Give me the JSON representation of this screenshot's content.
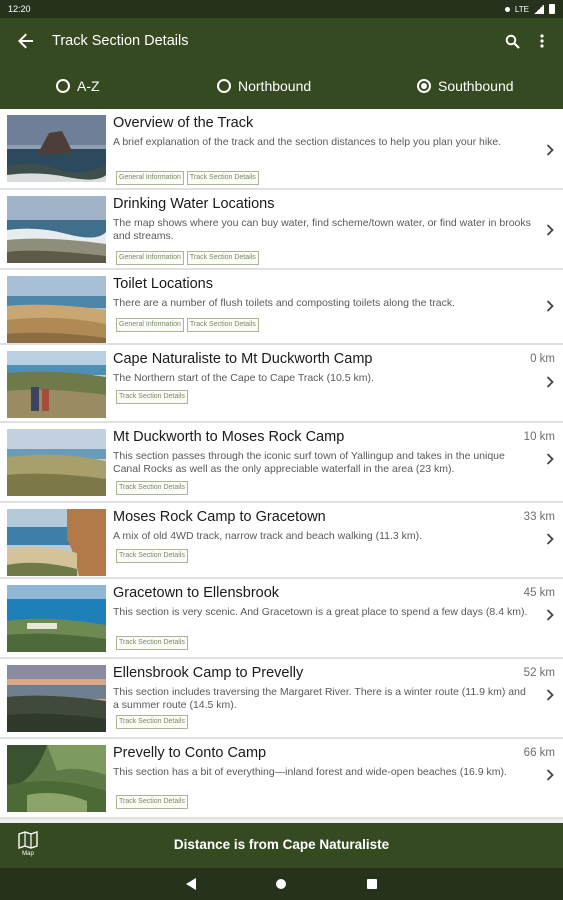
{
  "status": {
    "time": "12:20",
    "network": "LTE"
  },
  "appbar": {
    "title": "Track Section Details"
  },
  "sort": {
    "options": [
      "A-Z",
      "Northbound",
      "Southbound"
    ],
    "selected": "Southbound"
  },
  "items": [
    {
      "title": "Overview of the Track",
      "distance": "",
      "description": "A brief explanation of the track and the section distances to help you plan your hike.",
      "tags": [
        "General Information",
        "Track Section Details"
      ]
    },
    {
      "title": "Drinking Water Locations",
      "distance": "",
      "description": "The map shows where you can buy water, find scheme/town water, or find water in brooks and streams.",
      "tags": [
        "General Information",
        "Track Section Details"
      ]
    },
    {
      "title": "Toilet Locations",
      "distance": "",
      "description": "There are a number of flush toilets and composting toilets along the track.",
      "tags": [
        "General Information",
        "Track Section Details"
      ]
    },
    {
      "title": "Cape Naturaliste to Mt Duckworth Camp",
      "distance": "0 km",
      "description": "The Northern start of the Cape to Cape Track (10.5 km).",
      "tags": [
        "Track Section Details"
      ]
    },
    {
      "title": "Mt Duckworth to Moses Rock Camp",
      "distance": "10 km",
      "description": "This section passes through the iconic surf town of Yallingup and takes in the unique Canal Rocks as well as the only appreciable waterfall in the area (23 km).",
      "tags": [
        "Track Section Details"
      ]
    },
    {
      "title": "Moses Rock Camp to Gracetown",
      "distance": "33 km",
      "description": "A mix of old 4WD track, narrow track and beach walking (11.3 km).",
      "tags": [
        "Track Section Details"
      ]
    },
    {
      "title": "Gracetown to Ellensbrook",
      "distance": "45 km",
      "description": "This section is very scenic. And Gracetown is a great place to spend a few days (8.4 km).",
      "tags": [
        "Track Section Details"
      ]
    },
    {
      "title": "Ellensbrook Camp to Prevelly",
      "distance": "52 km",
      "description": "This section includes traversing the Margaret River. There is a winter route (11.9 km) and a summer route (14.5 km).",
      "tags": [
        "Track Section Details"
      ]
    },
    {
      "title": "Prevelly to Conto Camp",
      "distance": "66 km",
      "description": "This section has a bit of everything—inland forest and wide-open beaches (16.9 km).",
      "tags": [
        "Track Section Details"
      ]
    }
  ],
  "bottombar": {
    "map_label": "Map",
    "caption": "Distance is from Cape Naturaliste"
  },
  "colors": {
    "primary": "#364a22",
    "status_bar": "#26321b",
    "tag_border": "#a9b696",
    "tag_text": "#7b8a66"
  },
  "icons": {
    "back": "arrow-left-icon",
    "search": "search-icon",
    "overflow": "more-vert-icon",
    "chevron": "chevron-right-icon",
    "map": "map-icon"
  }
}
